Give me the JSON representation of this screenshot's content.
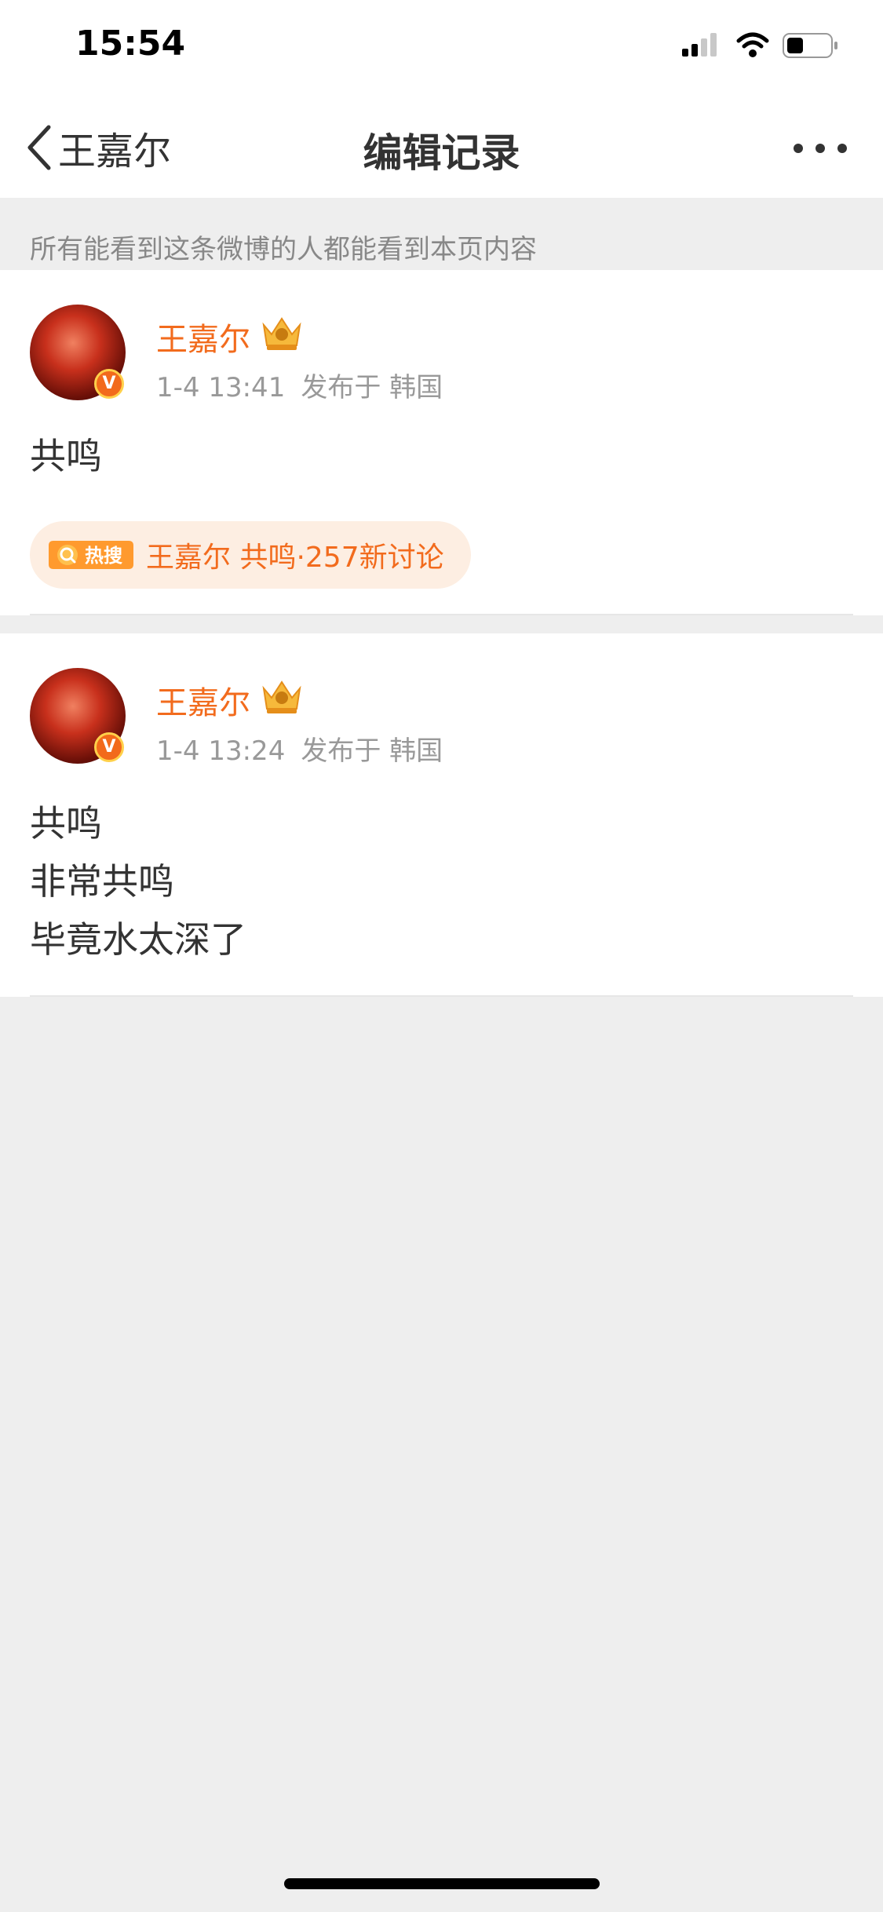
{
  "status_bar": {
    "time": "15:54"
  },
  "navbar": {
    "back_label": "王嘉尔",
    "title": "编辑记录"
  },
  "notice": "所有能看到这条微博的人都能看到本页内容",
  "posts": [
    {
      "username": "王嘉尔",
      "date": "1-4 13:41",
      "source": "发布于 韩国",
      "lines": [
        "共鸣"
      ],
      "hot_search": {
        "tag": "热搜",
        "text": "王嘉尔 共鸣·257新讨论"
      }
    },
    {
      "username": "王嘉尔",
      "date": "1-4 13:24",
      "source": "发布于 韩国",
      "lines": [
        "共鸣",
        "非常共鸣",
        "毕竟水太深了"
      ]
    }
  ],
  "badge": {
    "verified": "V"
  },
  "colors": {
    "accent": "#f26b1d",
    "background": "#eeeeee",
    "text": "#333333",
    "meta": "#999999"
  }
}
